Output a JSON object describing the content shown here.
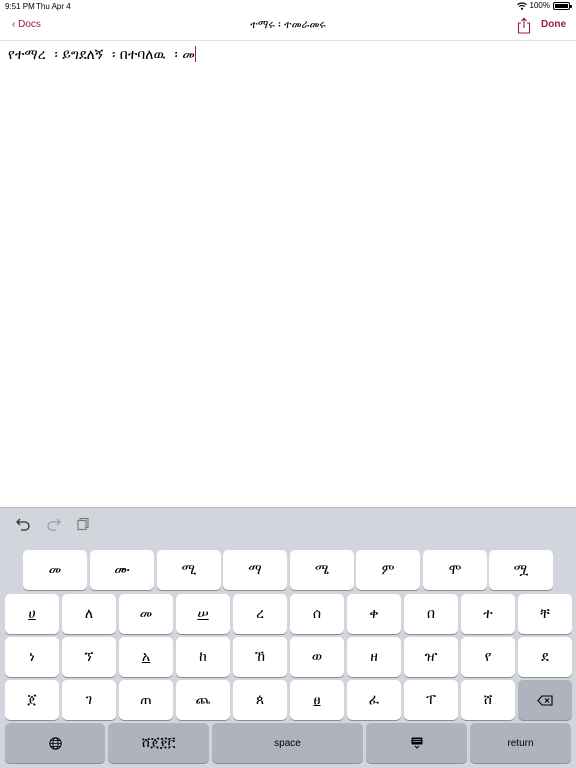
{
  "status_bar": {
    "time": "9:51 PM",
    "date": "Thu Apr 4",
    "battery": "100%",
    "battery_level": 1.0
  },
  "nav": {
    "back_label": "‹ Docs",
    "title": "ተማሩ    ፡ ተመራመሩ",
    "done_label": "Done"
  },
  "document": {
    "text": "የተማረ  ፡ ይግደለኝ  ፡ በተባለዉ  ፡ መ"
  },
  "keyboard": {
    "suggestions": [
      "መ",
      "ሙ",
      "ሚ",
      "ማ",
      "ሜ",
      "ም",
      "ሞ",
      "ሟ"
    ],
    "row1": [
      "ሀ",
      "ለ",
      "መ",
      "ሠ",
      "ረ",
      "ሰ",
      "ቀ",
      "በ",
      "ተ",
      "ቸ"
    ],
    "row2": [
      "ነ",
      "ኘ",
      "አ",
      "ከ",
      "ኸ",
      "ወ",
      "ዘ",
      "ዠ",
      "የ",
      "ደ"
    ],
    "row3": [
      "ጀ",
      "ገ",
      "ጠ",
      "ጨ",
      "ጰ",
      "ፀ",
      "ፈ",
      "ፐ",
      "ሸ"
    ],
    "mode_label": "ሸጀ፻፫",
    "space_label": "space",
    "return_label": "return"
  },
  "colors": {
    "accent": "#a0174e",
    "keyboard_bg": "#d2d5db",
    "key_dark": "#aeb3bd"
  },
  "icons": [
    "wifi-icon",
    "battery-icon",
    "share-icon",
    "undo-icon",
    "redo-icon",
    "paste-icon",
    "backspace-icon",
    "globe-icon",
    "keyboard-dismiss-icon"
  ]
}
